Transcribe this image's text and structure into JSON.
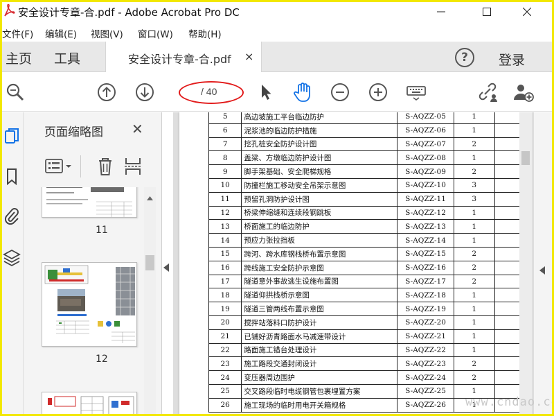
{
  "window": {
    "title": "安全设计专章-合.pdf - Adobe Acrobat Pro DC"
  },
  "menu": [
    "文件(F)",
    "编辑(E)",
    "视图(V)",
    "窗口(W)",
    "帮助(H)"
  ],
  "tabs": {
    "home": "主页",
    "tools": "工具",
    "doc": "安全设计专章-合.pdf",
    "doc_close": "×"
  },
  "header": {
    "help": "?",
    "login": "登录"
  },
  "toolbar": {
    "page_current": "",
    "page_total": "/ 40"
  },
  "panel": {
    "title": "页面缩略图",
    "close": "✕",
    "thumbnails": [
      {
        "page": "11"
      },
      {
        "page": "12"
      }
    ]
  },
  "table": {
    "rows": [
      {
        "no": "5",
        "name": "高边坡施工平台临边防护",
        "code": "S-AQZZ-05",
        "qty": "1"
      },
      {
        "no": "6",
        "name": "泥浆池的临边防护措施",
        "code": "S-AQZZ-06",
        "qty": "1"
      },
      {
        "no": "7",
        "name": "挖孔桩安全防护设计图",
        "code": "S-AQZZ-07",
        "qty": "2"
      },
      {
        "no": "8",
        "name": "盖梁、方墩临边防护设计图",
        "code": "S-AQZZ-08",
        "qty": "1"
      },
      {
        "no": "9",
        "name": "脚手架基础、安全爬梯规格",
        "code": "S-AQZZ-09",
        "qty": "2"
      },
      {
        "no": "10",
        "name": "防撞栏施工移动安全吊架示意图",
        "code": "S-AQZZ-10",
        "qty": "3"
      },
      {
        "no": "11",
        "name": "预留孔洞防护设计图",
        "code": "S-AQZZ-11",
        "qty": "3"
      },
      {
        "no": "12",
        "name": "桥梁伸缩缝和连续段钢跳板",
        "code": "S-AQZZ-12",
        "qty": "1"
      },
      {
        "no": "13",
        "name": "桥面施工的临边防护",
        "code": "S-AQZZ-13",
        "qty": "1"
      },
      {
        "no": "14",
        "name": "预应力张拉挡板",
        "code": "S-AQZZ-14",
        "qty": "1"
      },
      {
        "no": "15",
        "name": "跨河、跨水库钢栈桥布置示意图",
        "code": "S-AQZZ-15",
        "qty": "2"
      },
      {
        "no": "16",
        "name": "跨线施工安全防护示意图",
        "code": "S-AQZZ-16",
        "qty": "2"
      },
      {
        "no": "17",
        "name": "隧道意外事故逃生设施布置图",
        "code": "S-AQZZ-17",
        "qty": "2"
      },
      {
        "no": "18",
        "name": "隧道仰拱栈桥示意图",
        "code": "S-AQZZ-18",
        "qty": "1"
      },
      {
        "no": "19",
        "name": "隧道三管两线布置示意图",
        "code": "S-AQZZ-19",
        "qty": "1"
      },
      {
        "no": "20",
        "name": "搅拌站落料口防护设计",
        "code": "S-AQZZ-20",
        "qty": "1"
      },
      {
        "no": "21",
        "name": "已铺好沥青路面水马减速带设计",
        "code": "S-AQZZ-21",
        "qty": "1"
      },
      {
        "no": "22",
        "name": "路面施工错台处理设计",
        "code": "S-AQZZ-22",
        "qty": "1"
      },
      {
        "no": "23",
        "name": "施工路段交通封闭设计",
        "code": "S-AQZZ-23",
        "qty": "2"
      },
      {
        "no": "24",
        "name": "变压器周边围护",
        "code": "S-AQZZ-24",
        "qty": "2"
      },
      {
        "no": "25",
        "name": "交叉路段临时电缆钢管包裹埋置方案",
        "code": "S-AQZZ-25",
        "qty": "1"
      },
      {
        "no": "26",
        "name": "施工现场的临时用电开关箱规格",
        "code": "S-AQZZ-26",
        "qty": "1"
      }
    ]
  },
  "watermark": "www.cndao.com",
  "colors": {
    "frame": "#f2e800",
    "highlight": "#e21b1b",
    "acrobat_red": "#d7282f"
  }
}
